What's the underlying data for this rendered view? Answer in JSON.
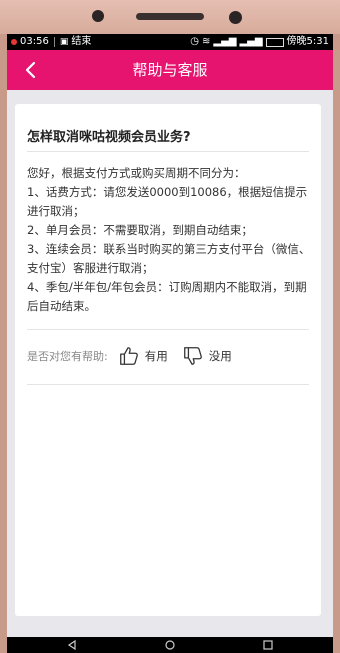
{
  "status": {
    "time": "03:56",
    "notification": "结束",
    "right_time": "傍晚5:31"
  },
  "header": {
    "title": "帮助与客服"
  },
  "article": {
    "question": "怎样取消咪咕视频会员业务?",
    "answer_lines": [
      "您好，根据支付方式或购买周期不同分为：",
      "1、话费方式：请您发送0000到10086，根据短信提示进行取消；",
      "2、单月会员：不需要取消，到期自动结束；",
      "3、连续会员：联系当时购买的第三方支付平台（微信、支付宝）客服进行取消；",
      "4、季包/半年包/年包会员：订购周期内不能取消，到期后自动结束。"
    ]
  },
  "feedback": {
    "label": "是否对您有帮助:",
    "useful": "有用",
    "useless": "没用"
  },
  "colors": {
    "brand": "#e6146f"
  }
}
